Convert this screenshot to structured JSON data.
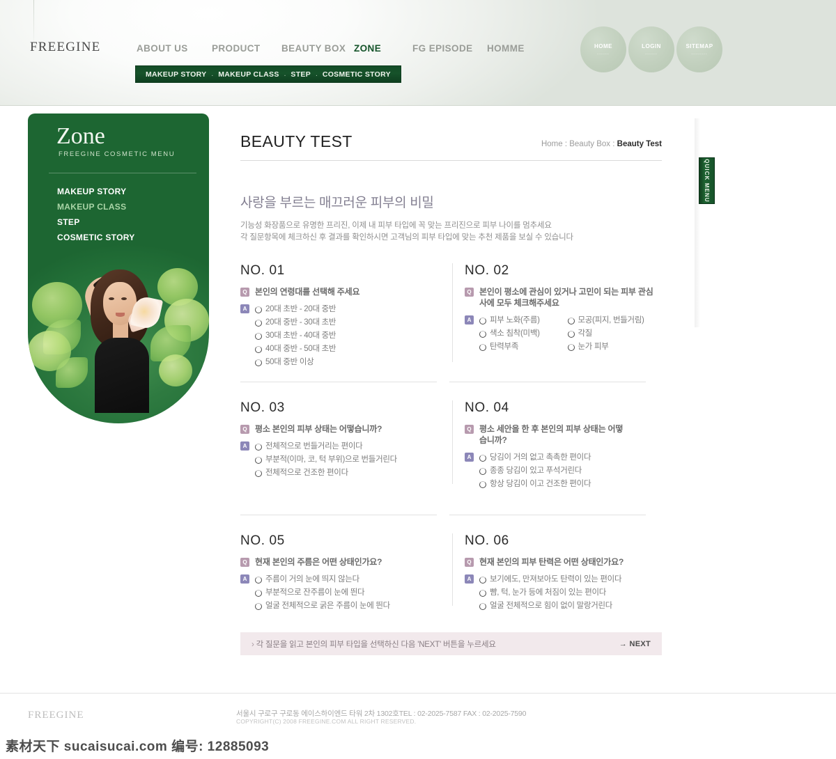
{
  "header": {
    "logo": "FREEGINE",
    "nav": [
      {
        "label": "ABOUT US",
        "active": false
      },
      {
        "label": "PRODUCT",
        "active": false
      },
      {
        "label": "BEAUTY BOX",
        "active": false
      },
      {
        "label": "ZONE",
        "active": true
      },
      {
        "label": "FG EPISODE",
        "active": false
      },
      {
        "label": "HOMME",
        "active": false
      }
    ],
    "subnav": [
      "MAKEUP STORY",
      "MAKEUP CLASS",
      "STEP",
      "COSMETIC STORY"
    ],
    "subnav_separator": ".",
    "circles": [
      {
        "label": "HOME",
        "dots": "......"
      },
      {
        "label": "LOGIN",
        "dots": "......"
      },
      {
        "label": "SITEMAP",
        "dots": "........"
      }
    ]
  },
  "sidebar": {
    "title": "Zone",
    "subtitle": "FREEGINE COSMETIC MENU",
    "items": [
      {
        "label": "MAKEUP STORY",
        "dim": false
      },
      {
        "label": "MAKEUP CLASS",
        "dim": true
      },
      {
        "label": "STEP",
        "dim": false
      },
      {
        "label": "COSMETIC STORY",
        "dim": false
      }
    ]
  },
  "quick_menu": {
    "label": "QUICK MENU"
  },
  "content": {
    "page_title": "BEAUTY TEST",
    "breadcrumb_path": "Home : Beauty Box : ",
    "breadcrumb_current": "Beauty Test",
    "lead_heading": "사랑을 부르는 매끄러운 피부의 비밀",
    "lead_line1": "기능성 화장품으로 유명한 프리진, 이제 내 피부 타입에 꼭 맞는 프리진으로 피부 나이를 멈추세요",
    "lead_line2": "각 질문항목에 체크하신 후 결과를 확인하시면 고객님의 피부 타입에 맞는 추천 제품을 보실 수 있습니다"
  },
  "badges": {
    "question": "Q",
    "answer": "A"
  },
  "questions": [
    {
      "number": "NO. 01",
      "question": "본인의 연령대를 선택해 주세요",
      "columns": 1,
      "options": [
        "20대 초반 - 20대 중반",
        "20대 중반 - 30대 초반",
        "30대 초반 - 40대 중반",
        "40대 중반 - 50대 초반",
        "50대 중반 이상"
      ]
    },
    {
      "number": "NO. 02",
      "question": "본인이 평소에 관심이 있거나 고민이 되는 피부 관심사에 모두 체크해주세요",
      "columns": 2,
      "options": [
        "피부 노화(주름)",
        "모공(피지, 번들거림)",
        "색소 침착(미백)",
        "각질",
        "탄력부족",
        "눈가 피부"
      ]
    },
    {
      "number": "NO. 03",
      "question": "평소 본인의 피부 상태는 어떻습니까?",
      "columns": 1,
      "options": [
        "전체적으로 번들거리는 편이다",
        "부분적(이마, 코, 턱 부위)으로 번들거린다",
        "전체적으로 건조한 편이다"
      ]
    },
    {
      "number": "NO. 04",
      "question": "평소 세안을 한 후 본인의 피부 상태는 어떻습니까?",
      "columns": 1,
      "options": [
        "당김이 거의 없고 촉촉한 편이다",
        "종종 당김이 있고 푸석거린다",
        "항상 당김이 이고 건조한 편이다"
      ]
    },
    {
      "number": "NO. 05",
      "question": "현재 본인의 주름은 어떤 상태인가요?",
      "columns": 1,
      "options": [
        "주름이 거의 눈에 띄지 않는다",
        "부분적으로 잔주름이 눈에 띈다",
        "얼굴 전체적으로 굵은 주름이 눈에 띈다"
      ]
    },
    {
      "number": "NO. 06",
      "question": "현재 본인의 피부 탄력은 어떤 상태인가요?",
      "columns": 1,
      "options": [
        "보기에도, 만져보아도 탄력이 있는 편이다",
        "뺨, 턱, 눈가 등에 처짐이 있는 편이다",
        "얼굴 전체적으로 힘이 없이 말랑거린다"
      ]
    }
  ],
  "next_bar": {
    "arrow": "›",
    "text": "각 질문을 읽고 본인의 피부 타입을 선택하신 다음 'NEXT' 버튼을 누르세요",
    "button": "→ NEXT"
  },
  "footer": {
    "logo": "FREEGINE",
    "address": "서울시 구로구 구로동 에이스하이엔드 타워 2차 1302호TEL : 02-2025-7587   FAX : 02-2025-7590",
    "copyright": "COPYRIGHT(C) 2008 FREEGINE.COM ALL RIGHT RESERVED."
  },
  "watermark": "素材天下 sucaisucai.com  编号: 12885093",
  "colors": {
    "brand_green": "#14502a",
    "sidebar_green": "#246f36",
    "badge_q": "#b79aae",
    "badge_a": "#8c87b8",
    "next_bar_bg": "#f2e9ec",
    "lead_text": "#837f91"
  }
}
